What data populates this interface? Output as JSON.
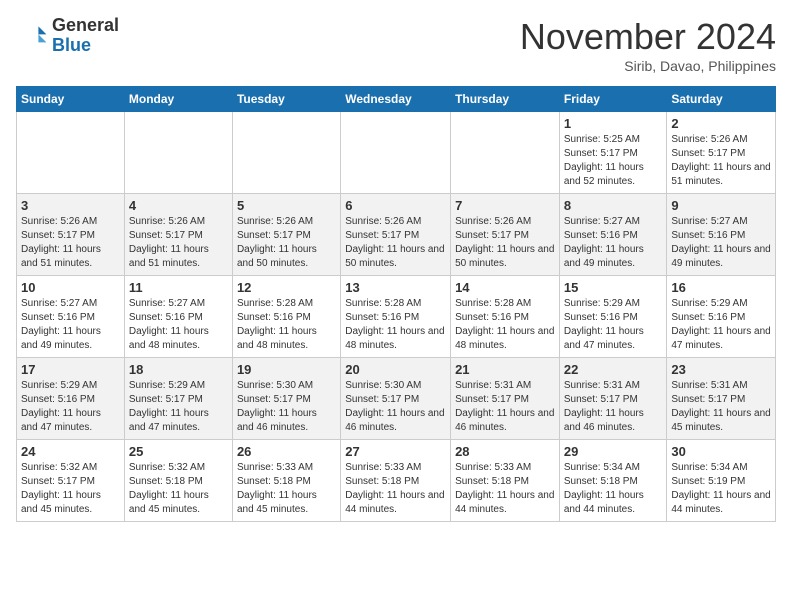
{
  "header": {
    "logo_general": "General",
    "logo_blue": "Blue",
    "month_title": "November 2024",
    "location": "Sirib, Davao, Philippines"
  },
  "calendar": {
    "days_of_week": [
      "Sunday",
      "Monday",
      "Tuesday",
      "Wednesday",
      "Thursday",
      "Friday",
      "Saturday"
    ],
    "weeks": [
      [
        {
          "day": "",
          "info": ""
        },
        {
          "day": "",
          "info": ""
        },
        {
          "day": "",
          "info": ""
        },
        {
          "day": "",
          "info": ""
        },
        {
          "day": "",
          "info": ""
        },
        {
          "day": "1",
          "info": "Sunrise: 5:25 AM\nSunset: 5:17 PM\nDaylight: 11 hours and 52 minutes."
        },
        {
          "day": "2",
          "info": "Sunrise: 5:26 AM\nSunset: 5:17 PM\nDaylight: 11 hours and 51 minutes."
        }
      ],
      [
        {
          "day": "3",
          "info": "Sunrise: 5:26 AM\nSunset: 5:17 PM\nDaylight: 11 hours and 51 minutes."
        },
        {
          "day": "4",
          "info": "Sunrise: 5:26 AM\nSunset: 5:17 PM\nDaylight: 11 hours and 51 minutes."
        },
        {
          "day": "5",
          "info": "Sunrise: 5:26 AM\nSunset: 5:17 PM\nDaylight: 11 hours and 50 minutes."
        },
        {
          "day": "6",
          "info": "Sunrise: 5:26 AM\nSunset: 5:17 PM\nDaylight: 11 hours and 50 minutes."
        },
        {
          "day": "7",
          "info": "Sunrise: 5:26 AM\nSunset: 5:17 PM\nDaylight: 11 hours and 50 minutes."
        },
        {
          "day": "8",
          "info": "Sunrise: 5:27 AM\nSunset: 5:16 PM\nDaylight: 11 hours and 49 minutes."
        },
        {
          "day": "9",
          "info": "Sunrise: 5:27 AM\nSunset: 5:16 PM\nDaylight: 11 hours and 49 minutes."
        }
      ],
      [
        {
          "day": "10",
          "info": "Sunrise: 5:27 AM\nSunset: 5:16 PM\nDaylight: 11 hours and 49 minutes."
        },
        {
          "day": "11",
          "info": "Sunrise: 5:27 AM\nSunset: 5:16 PM\nDaylight: 11 hours and 48 minutes."
        },
        {
          "day": "12",
          "info": "Sunrise: 5:28 AM\nSunset: 5:16 PM\nDaylight: 11 hours and 48 minutes."
        },
        {
          "day": "13",
          "info": "Sunrise: 5:28 AM\nSunset: 5:16 PM\nDaylight: 11 hours and 48 minutes."
        },
        {
          "day": "14",
          "info": "Sunrise: 5:28 AM\nSunset: 5:16 PM\nDaylight: 11 hours and 48 minutes."
        },
        {
          "day": "15",
          "info": "Sunrise: 5:29 AM\nSunset: 5:16 PM\nDaylight: 11 hours and 47 minutes."
        },
        {
          "day": "16",
          "info": "Sunrise: 5:29 AM\nSunset: 5:16 PM\nDaylight: 11 hours and 47 minutes."
        }
      ],
      [
        {
          "day": "17",
          "info": "Sunrise: 5:29 AM\nSunset: 5:16 PM\nDaylight: 11 hours and 47 minutes."
        },
        {
          "day": "18",
          "info": "Sunrise: 5:29 AM\nSunset: 5:17 PM\nDaylight: 11 hours and 47 minutes."
        },
        {
          "day": "19",
          "info": "Sunrise: 5:30 AM\nSunset: 5:17 PM\nDaylight: 11 hours and 46 minutes."
        },
        {
          "day": "20",
          "info": "Sunrise: 5:30 AM\nSunset: 5:17 PM\nDaylight: 11 hours and 46 minutes."
        },
        {
          "day": "21",
          "info": "Sunrise: 5:31 AM\nSunset: 5:17 PM\nDaylight: 11 hours and 46 minutes."
        },
        {
          "day": "22",
          "info": "Sunrise: 5:31 AM\nSunset: 5:17 PM\nDaylight: 11 hours and 46 minutes."
        },
        {
          "day": "23",
          "info": "Sunrise: 5:31 AM\nSunset: 5:17 PM\nDaylight: 11 hours and 45 minutes."
        }
      ],
      [
        {
          "day": "24",
          "info": "Sunrise: 5:32 AM\nSunset: 5:17 PM\nDaylight: 11 hours and 45 minutes."
        },
        {
          "day": "25",
          "info": "Sunrise: 5:32 AM\nSunset: 5:18 PM\nDaylight: 11 hours and 45 minutes."
        },
        {
          "day": "26",
          "info": "Sunrise: 5:33 AM\nSunset: 5:18 PM\nDaylight: 11 hours and 45 minutes."
        },
        {
          "day": "27",
          "info": "Sunrise: 5:33 AM\nSunset: 5:18 PM\nDaylight: 11 hours and 44 minutes."
        },
        {
          "day": "28",
          "info": "Sunrise: 5:33 AM\nSunset: 5:18 PM\nDaylight: 11 hours and 44 minutes."
        },
        {
          "day": "29",
          "info": "Sunrise: 5:34 AM\nSunset: 5:18 PM\nDaylight: 11 hours and 44 minutes."
        },
        {
          "day": "30",
          "info": "Sunrise: 5:34 AM\nSunset: 5:19 PM\nDaylight: 11 hours and 44 minutes."
        }
      ]
    ]
  }
}
